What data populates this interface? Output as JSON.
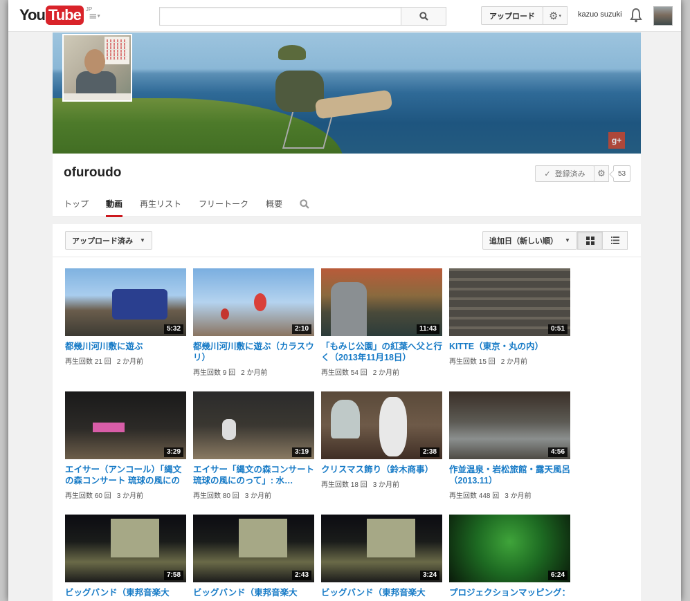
{
  "masthead": {
    "logo_you": "You",
    "logo_tube": "Tube",
    "logo_region": "JP",
    "search_placeholder": "",
    "upload_label": "アップロード",
    "username": "kazuo suzuki"
  },
  "channel": {
    "title": "ofuroudo",
    "subscribed_label": "登録済み",
    "subscriber_count": "53",
    "tabs": [
      "トップ",
      "動画",
      "再生リスト",
      "フリートーク",
      "概要"
    ],
    "active_tab": "動画"
  },
  "filters": {
    "uploads_label": "アップロード済み",
    "sort_label": "追加日（新しい順）"
  },
  "videos": [
    {
      "title": "都幾川河川敷に遊ぶ",
      "views": "再生回数 21 回",
      "age": "2 か月前",
      "duration": "5:32"
    },
    {
      "title": "都幾川河川敷に遊ぶ（カラスウリ）",
      "views": "再生回数 9 回",
      "age": "2 か月前",
      "duration": "2:10"
    },
    {
      "title": "「もみじ公園」の紅葉へ父と行く（2013年11月18日）",
      "views": "再生回数 54 回",
      "age": "2 か月前",
      "duration": "11:43"
    },
    {
      "title": "KITTE（東京・丸の内）",
      "views": "再生回数 15 回",
      "age": "2 か月前",
      "duration": "0:51"
    },
    {
      "title": "エイサー（アンコール）「縄文の森コンサート 琉球の風にのっ…",
      "views": "再生回数 60 回",
      "age": "3 か月前",
      "duration": "3:29"
    },
    {
      "title": "エイサー「縄文の森コンサート 琉球の風にのって」: 水…",
      "views": "再生回数 80 回",
      "age": "3 か月前",
      "duration": "3:19"
    },
    {
      "title": "クリスマス飾り（鈴木商事）",
      "views": "再生回数 18 回",
      "age": "3 か月前",
      "duration": "2:38"
    },
    {
      "title": "作並温泉・岩松旅館・露天風呂（2013.11）",
      "views": "再生回数 448 回",
      "age": "3 か月前",
      "duration": "4:56"
    },
    {
      "title": "ビッグバンド（東邦音楽大",
      "views": "",
      "age": "",
      "duration": "7:58"
    },
    {
      "title": "ビッグバンド（東邦音楽大",
      "views": "",
      "age": "",
      "duration": "2:43"
    },
    {
      "title": "ビッグバンド（東邦音楽大",
      "views": "",
      "age": "",
      "duration": "3:24"
    },
    {
      "title": "プロジェクションマッピング：",
      "views": "",
      "age": "",
      "duration": "6:24"
    }
  ]
}
